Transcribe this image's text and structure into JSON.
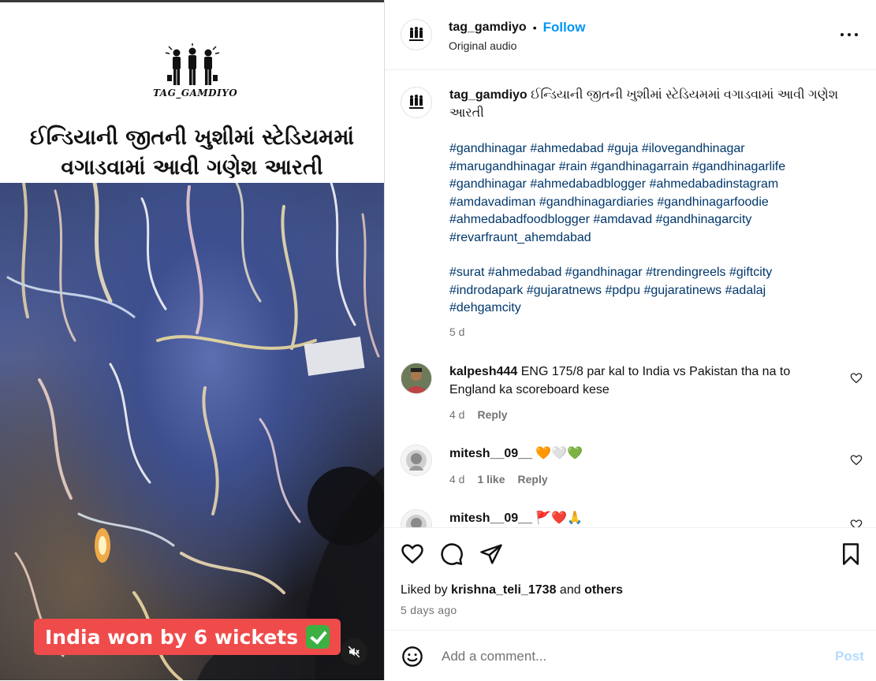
{
  "media": {
    "logo_text": "TAG_GAMDIYO",
    "headline_line1": "ઈન્ડિયાની જીતની ખુશીમાં સ્ટેડિયમમાં",
    "headline_line2": "વગાડવામાં આવી ગણેશ આરતી",
    "video_caption": "India won by 6 wickets"
  },
  "header": {
    "username": "tag_gamdiyo",
    "separator": "•",
    "follow_label": "Follow",
    "audio_label": "Original audio"
  },
  "post": {
    "username": "tag_gamdiyo",
    "caption": "ઈન્ડિયાની જીતની ખુશીમાં સ્ટેડિયમમાં વગાડવામાં આવી ગણેશ આરતી",
    "hashtags_block1": [
      "#gandhinagar",
      "#ahmedabad",
      "#guja",
      "#ilovegandhinagar",
      "#marugandhinagar",
      "#rain",
      "#gandhinagarrain",
      "#gandhinagarlife",
      "#gandhinagar",
      "#ahmedabadblogger",
      "#ahmedabadinstagram",
      "#amdavadiman",
      "#gandhinagardiaries",
      "#gandhinagarfoodie",
      "#ahmedabadfoodblogger",
      "#amdavad",
      "#gandhinagarcity",
      "#revarfraunt_ahemdabad"
    ],
    "hashtags_block2": [
      "#surat",
      "#ahmedabad",
      "#gandhinagar",
      "#trendingreels",
      "#giftcity",
      "#indrodapark",
      "#gujaratnews",
      "#pdpu",
      "#gujaratinews",
      "#adalaj",
      "#dehgamcity"
    ],
    "age": "5 d"
  },
  "comments": [
    {
      "username": "kalpesh444",
      "text": "ENG 175/8 par kal to India vs Pakistan tha na to England ka scoreboard kese",
      "age": "4 d",
      "likes": "",
      "reply_label": "Reply"
    },
    {
      "username": "mitesh__09__",
      "text": "🧡🤍💚",
      "age": "4 d",
      "likes": "1 like",
      "reply_label": "Reply"
    },
    {
      "username": "mitesh__09__",
      "text": "🚩❤️🙏",
      "age": "",
      "likes": "",
      "reply_label": ""
    }
  ],
  "actions": {
    "liked_prefix": "Liked by",
    "liked_user": "krishna_teli_1738",
    "liked_and": "and",
    "liked_others": "others",
    "timestamp": "5 days ago"
  },
  "composer": {
    "placeholder": "Add a comment...",
    "post_label": "Post"
  },
  "colors": {
    "link_blue": "#0095f6",
    "hashtag": "#00376b",
    "caption_pill": "#f04b4b",
    "muted_text": "#737373"
  },
  "icons": [
    "men-logo-icon",
    "mute-icon",
    "more-icon",
    "heart-icon",
    "comment-icon",
    "share-icon",
    "bookmark-icon",
    "emoji-icon",
    "small-heart-icon"
  ]
}
